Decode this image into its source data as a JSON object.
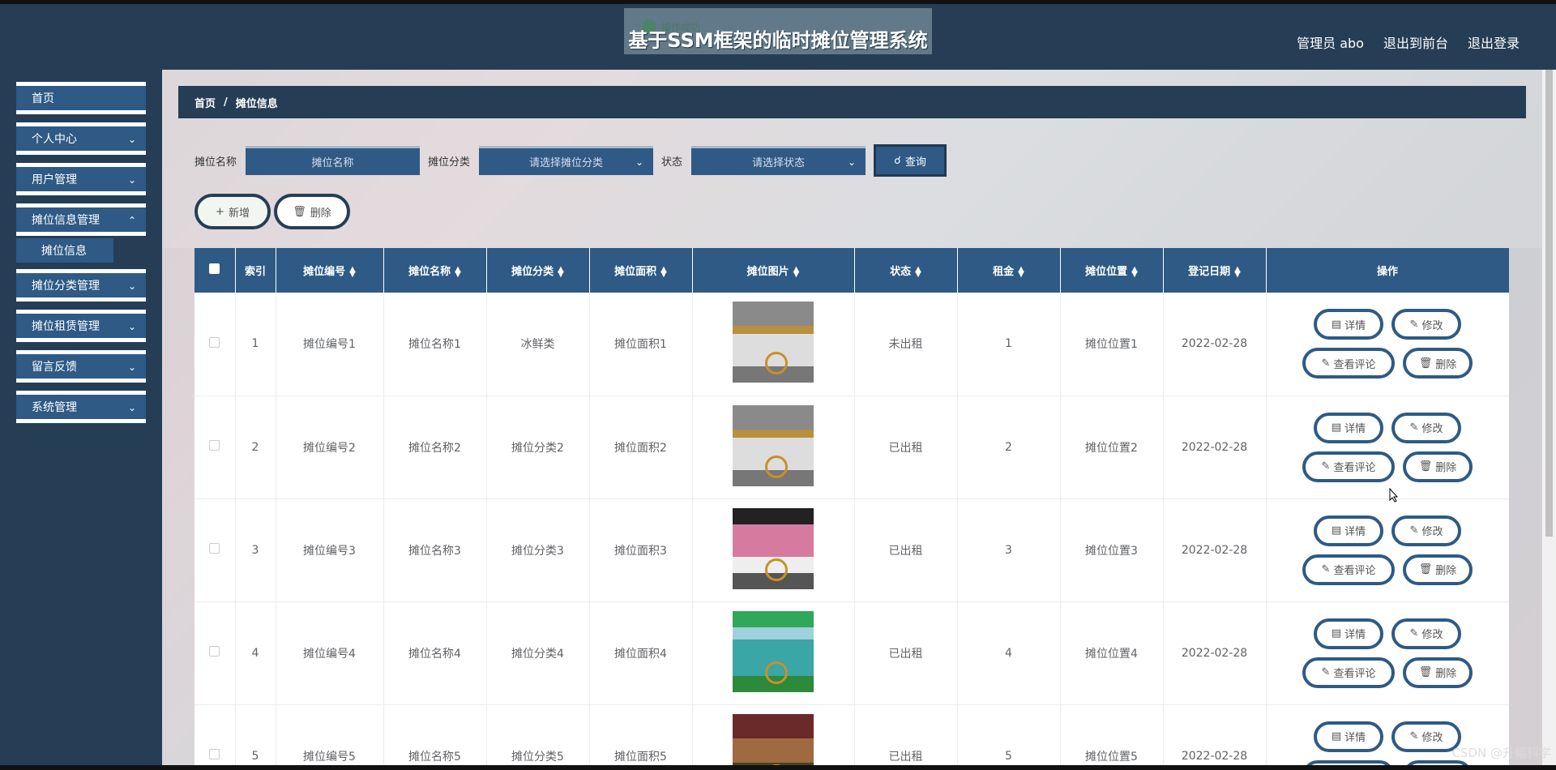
{
  "header": {
    "title": "基于SSM框架的临时摊位管理系统",
    "toast": "操作成功",
    "admin": "管理员 abo",
    "to_front": "退出到前台",
    "logout": "退出登录"
  },
  "sidebar": {
    "items": [
      {
        "label": "首页"
      },
      {
        "label": "个人中心"
      },
      {
        "label": "用户管理"
      },
      {
        "label": "摊位信息管理"
      },
      {
        "label": "摊位分类管理"
      },
      {
        "label": "摊位租赁管理"
      },
      {
        "label": "留言反馈"
      },
      {
        "label": "系统管理"
      }
    ],
    "sub_item": "摊位信息"
  },
  "breadcrumb": {
    "home": "首页",
    "sep": "/",
    "current": "摊位信息"
  },
  "search": {
    "name_label": "摊位名称",
    "name_placeholder": "摊位名称",
    "category_label": "摊位分类",
    "category_placeholder": "请选择摊位分类",
    "status_label": "状态",
    "status_placeholder": "请选择状态",
    "query": "查询"
  },
  "actions": {
    "add": "新增",
    "delete": "删除"
  },
  "table": {
    "headers": [
      "索引",
      "摊位编号",
      "摊位名称",
      "摊位分类",
      "摊位面积",
      "摊位图片",
      "状态",
      "租金",
      "摊位位置",
      "登记日期",
      "操作"
    ],
    "rows": [
      {
        "index": "1",
        "code": "摊位编号1",
        "name": "摊位名称1",
        "category": "冰鲜类",
        "area": "摊位面积1",
        "status": "未出租",
        "rent": "1",
        "location": "摊位位置1",
        "date": "2022-02-28"
      },
      {
        "index": "2",
        "code": "摊位编号2",
        "name": "摊位名称2",
        "category": "摊位分类2",
        "area": "摊位面积2",
        "status": "已出租",
        "rent": "2",
        "location": "摊位位置2",
        "date": "2022-02-28"
      },
      {
        "index": "3",
        "code": "摊位编号3",
        "name": "摊位名称3",
        "category": "摊位分类3",
        "area": "摊位面积3",
        "status": "已出租",
        "rent": "3",
        "location": "摊位位置3",
        "date": "2022-02-28"
      },
      {
        "index": "4",
        "code": "摊位编号4",
        "name": "摊位名称4",
        "category": "摊位分类4",
        "area": "摊位面积4",
        "status": "已出租",
        "rent": "4",
        "location": "摊位位置4",
        "date": "2022-02-28"
      },
      {
        "index": "5",
        "code": "摊位编号5",
        "name": "摊位名称5",
        "category": "摊位分类5",
        "area": "摊位面积5",
        "status": "已出租",
        "rent": "5",
        "location": "摊位位置5",
        "date": "2022-02-28"
      }
    ],
    "ops": {
      "detail": "详情",
      "edit": "修改",
      "comments": "查看评论",
      "delete": "删除"
    }
  },
  "watermark": "CSDN @升幅科学",
  "colors": {
    "primary": "#2e5a85",
    "dark": "#253e55"
  }
}
